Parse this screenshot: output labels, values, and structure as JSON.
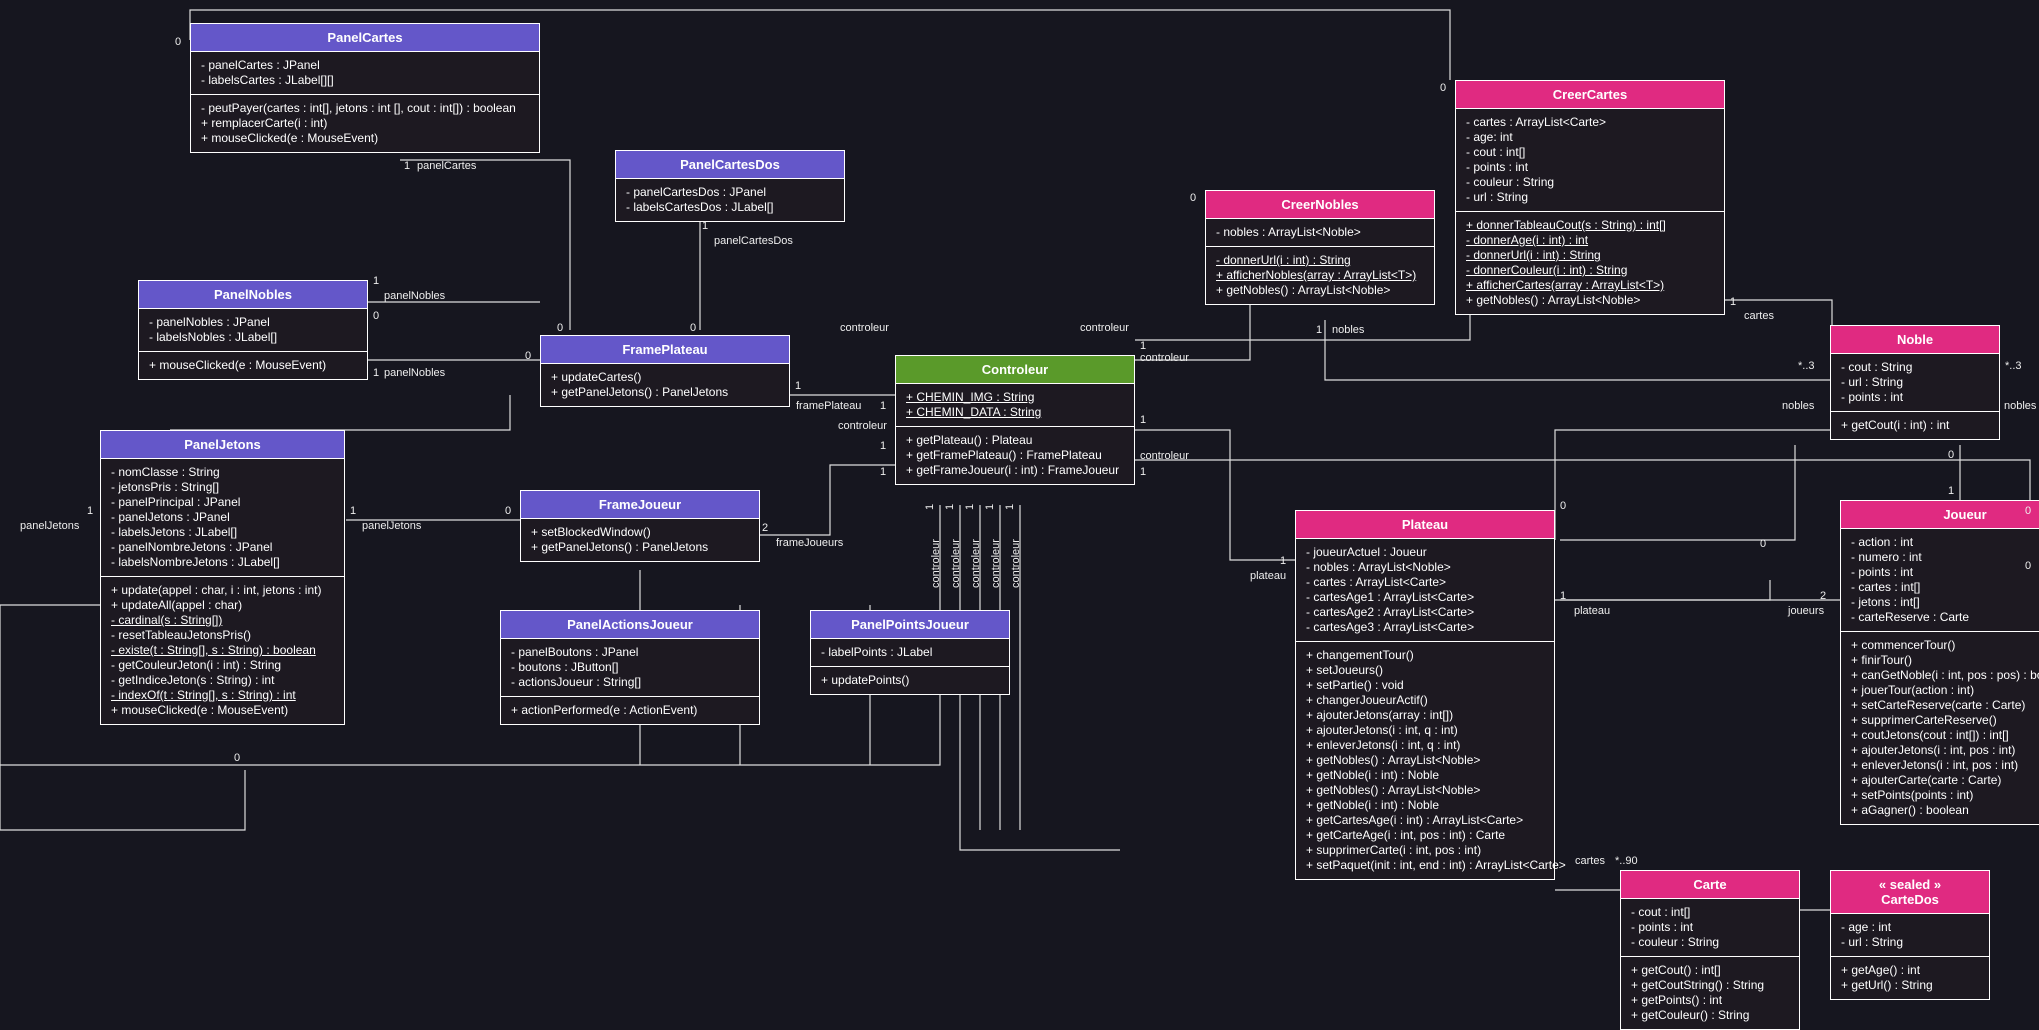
{
  "classes": {
    "PanelCartes": {
      "name": "PanelCartes",
      "attrs": [
        "- panelCartes : JPanel",
        "- labelsCartes : JLabel[][]"
      ],
      "ops": [
        "- peutPayer(cartes : int[], jetons : int [], cout : int[]) : boolean",
        "+ remplacerCarte(i : int)",
        "+ mouseClicked(e : MouseEvent)"
      ]
    },
    "PanelCartesDos": {
      "name": "PanelCartesDos",
      "attrs": [
        "- panelCartesDos : JPanel",
        "- labelsCartesDos : JLabel[]"
      ],
      "ops": []
    },
    "PanelNobles": {
      "name": "PanelNobles",
      "attrs": [
        "- panelNobles : JPanel",
        "- labelsNobles : JLabel[]"
      ],
      "ops": [
        "+ mouseClicked(e : MouseEvent)"
      ]
    },
    "FramePlateau": {
      "name": "FramePlateau",
      "attrs": [],
      "ops": [
        "+ updateCartes()",
        "+ getPanelJetons() : PanelJetons"
      ]
    },
    "PanelJetons": {
      "name": "PanelJetons",
      "attrs": [
        "- nomClasse : String",
        "- jetonsPris : String[]",
        "- panelPrincipal : JPanel",
        "- panelJetons : JPanel",
        "- labelsJetons : JLabel[]",
        "- panelNombreJetons : JPanel",
        "- labelsNombreJetons : JLabel[]"
      ],
      "ops": [
        "+ update(appel : char, i : int, jetons : int)",
        "+ updateAll(appel : char)",
        "- cardinal(s : String[])",
        "- resetTableauJetonsPris()",
        "- existe(t : String[], s : String) : boolean",
        "- getCouleurJeton(i : int) : String",
        "- getIndiceJeton(s : String) : int",
        "- indexOf(t : String[], s : String) : int",
        "+ mouseClicked(e : MouseEvent)"
      ],
      "underlined_ops": [
        2,
        4,
        7
      ]
    },
    "FrameJoueur": {
      "name": "FrameJoueur",
      "attrs": [],
      "ops": [
        "+ setBlockedWindow()",
        "+ getPanelJetons() : PanelJetons"
      ]
    },
    "PanelActionsJoueur": {
      "name": "PanelActionsJoueur",
      "attrs": [
        "- panelBoutons : JPanel",
        "- boutons : JButton[]",
        "- actionsJoueur : String[]"
      ],
      "ops": [
        "+ actionPerformed(e : ActionEvent)"
      ]
    },
    "PanelPointsJoueur": {
      "name": "PanelPointsJoueur",
      "attrs": [
        "- labelPoints : JLabel"
      ],
      "ops": [
        "+ updatePoints()"
      ]
    },
    "Controleur": {
      "name": "Controleur",
      "attrs": [
        "+ CHEMIN_IMG : String",
        "+ CHEMIN_DATA : String"
      ],
      "ops": [
        "+ getPlateau() : Plateau",
        "+ getFramePlateau() : FramePlateau",
        "+ getFrameJoueur(i : int) : FrameJoueur"
      ],
      "underlined_attrs": [
        0,
        1
      ]
    },
    "CreerNobles": {
      "name": "CreerNobles",
      "attrs": [
        "- nobles : ArrayList<Noble>"
      ],
      "ops": [
        "- donnerUrl(i : int) : String",
        "+ afficherNobles(array : ArrayList<T>)",
        "+ getNobles() : ArrayList<Noble>"
      ],
      "underlined_ops": [
        0,
        1
      ]
    },
    "CreerCartes": {
      "name": "CreerCartes",
      "attrs": [
        "- cartes : ArrayList<Carte>",
        "- age: int",
        "- cout : int[]",
        "- points : int",
        "- couleur : String",
        "- url : String"
      ],
      "ops": [
        "+ donnerTableauCout(s : String) : int[]",
        "- donnerAge(i : int) : int",
        "- donnerUrl(i : int) : String",
        "- donnerCouleur(i : int) : String",
        "+ afficherCartes(array : ArrayList<T>)",
        "+ getNobles() : ArrayList<Noble>"
      ],
      "underlined_ops": [
        0,
        1,
        2,
        3,
        4
      ]
    },
    "Noble": {
      "name": "Noble",
      "attrs": [
        "- cout : String",
        "- url : String",
        "- points : int"
      ],
      "ops": [
        "+ getCout(i : int) : int"
      ]
    },
    "Joueur": {
      "name": "Joueur",
      "attrs": [
        "- action : int",
        "- numero : int",
        "- points : int",
        "- cartes : int[]",
        "- jetons : int[]",
        "- carteReserve : Carte"
      ],
      "ops": [
        "+ commencerTour()",
        "+ finirTour()",
        "+ canGetNoble(i : int, pos : pos) : boolean",
        "+ jouerTour(action : int)",
        "+ setCarteReserve(carte : Carte)",
        "+ supprimerCarteReserve()",
        "+ coutJetons(cout : int[]) : int[]",
        "+ ajouterJetons(i : int, pos : int)",
        "+ enleverJetons(i : int, pos : int)",
        "+ ajouterCarte(carte : Carte)",
        "+ setPoints(points : int)",
        "+ aGagner() : boolean"
      ]
    },
    "Plateau": {
      "name": "Plateau",
      "attrs": [
        "- joueurActuel : Joueur",
        "- nobles : ArrayList<Noble>",
        "- cartes : ArrayList<Carte>",
        "- cartesAge1 : ArrayList<Carte>",
        "- cartesAge2 : ArrayList<Carte>",
        "- cartesAge3 : ArrayList<Carte>"
      ],
      "ops": [
        "+ changementTour()",
        "+ setJoueurs()",
        "+ setPartie() : void",
        "+ changerJoueurActif()",
        "+ ajouterJetons(array : int[])",
        "+ ajouterJetons(i : int, q : int)",
        "+ enleverJetons(i : int, q : int)",
        "+ getNobles() : ArrayList<Noble>",
        "+ getNoble(i : int) : Noble",
        "+ getNobles() : ArrayList<Noble>",
        "+ getNoble(i : int) : Noble",
        "+ getCartesAge(i : int) : ArrayList<Carte>",
        "+ getCarteAge(i : int, pos : int) : Carte",
        "+ supprimerCarte(i : int, pos : int)",
        "+ setPaquet(init : int, end : int) : ArrayList<Carte>"
      ]
    },
    "Carte": {
      "name": "Carte",
      "attrs": [
        "- cout : int[]",
        "- points : int",
        "- couleur : String"
      ],
      "ops": [
        "+ getCout() : int[]",
        "+ getCoutString() : String",
        "+ getPoints() : int",
        "+ getCouleur() : String"
      ]
    },
    "CarteDos": {
      "name": "« sealed »\nCarteDos",
      "attrs": [
        "- age : int",
        "- url : String"
      ],
      "ops": [
        "+ getAge() : int",
        "+ getUrl() : String"
      ]
    }
  },
  "labels": {
    "panelCartes_role": "panelCartes",
    "panelCartesDos_role": "panelCartesDos",
    "panelNobles_role": "panelNobles",
    "panelJetons_role": "panelJetons",
    "framePlateau_role": "framePlateau",
    "frameJoueurs_role": "frameJoueurs",
    "controleur_role": "controleur",
    "nobles_role": "nobles",
    "cartes_role": "cartes",
    "plateau_role": "plateau",
    "joueurs_role": "joueurs",
    "m0": "0",
    "m1": "1",
    "m2": "2",
    "star3": "*..3",
    "star90": "*..90"
  }
}
